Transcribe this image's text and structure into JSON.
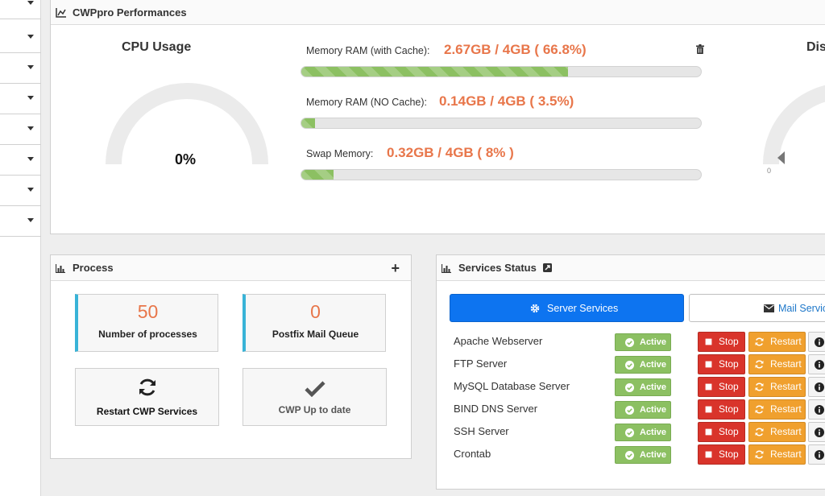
{
  "sidebar": {
    "rows": [
      {
        "name": "sidebar-row-1"
      },
      {
        "name": "sidebar-row-2"
      },
      {
        "name": "sidebar-row-3"
      },
      {
        "name": "sidebar-row-4"
      },
      {
        "name": "sidebar-row-5"
      },
      {
        "name": "sidebar-row-6"
      },
      {
        "name": "sidebar-row-7"
      },
      {
        "name": "sidebar-row-8"
      }
    ]
  },
  "performance": {
    "title": "CWPpro Performances",
    "cpu": {
      "title": "CPU Usage",
      "value": "0%",
      "percent": 0
    },
    "disk": {
      "title": "Dis",
      "zero_label": "0"
    },
    "memory_cache": {
      "label": "Memory RAM (with Cache):",
      "value": "2.67GB / 4GB ( 66.8%)",
      "percent": 66.8
    },
    "memory_nocache": {
      "label": "Memory RAM (NO Cache):",
      "value": "0.14GB / 4GB ( 3.5%)",
      "percent": 3.5
    },
    "swap": {
      "label": "Swap Memory:",
      "value": "0.32GB / 4GB ( 8% )",
      "percent": 8
    }
  },
  "process": {
    "title": "Process",
    "add_label": "+",
    "processes": {
      "value": "50",
      "label": "Number of processes"
    },
    "mail_queue": {
      "value": "0",
      "label": "Postfix Mail Queue"
    },
    "restart_label": "Restart CWP Services",
    "uptodate_label": "CWP Up to date"
  },
  "services": {
    "title": "Services Status",
    "tab_server": "Server Services",
    "tab_mail": "Mail Service",
    "active_label": "Active",
    "stop_label": "Stop",
    "restart_label": "Restart",
    "items": [
      {
        "name": "Apache Webserver"
      },
      {
        "name": "FTP Server"
      },
      {
        "name": "MySQL Database Server"
      },
      {
        "name": "BIND DNS Server"
      },
      {
        "name": "SSH Server"
      },
      {
        "name": "Crontab"
      }
    ]
  },
  "colors": {
    "accent_orange": "#e8764a",
    "progress_green": "#8cc062",
    "primary_blue": "#0d74f0",
    "stop_red": "#d9342b",
    "restart_orange": "#f0a02e",
    "process_border": "#39b3d7"
  }
}
